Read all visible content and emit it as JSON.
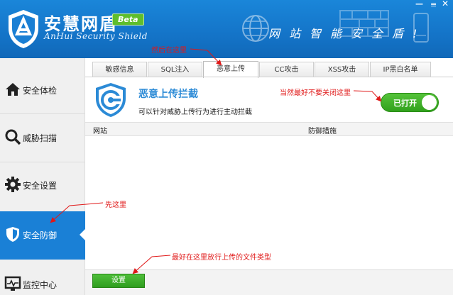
{
  "header": {
    "title": "安慧网盾",
    "badge": "Beta",
    "subtitle": "AnHui Security Shield",
    "slogan": "网站智能安全盾!"
  },
  "sidebar": {
    "items": [
      {
        "label": "安全体检",
        "icon": "home-icon"
      },
      {
        "label": "威胁扫描",
        "icon": "magnifier-icon"
      },
      {
        "label": "安全设置",
        "icon": "gear-icon"
      },
      {
        "label": "安全防御",
        "icon": "shield-icon",
        "active": true
      },
      {
        "label": "监控中心",
        "icon": "monitor-icon"
      }
    ]
  },
  "tabs": [
    {
      "label": "敏感信息"
    },
    {
      "label": "SQL注入"
    },
    {
      "label": "恶意上传",
      "active": true
    },
    {
      "label": "CC攻击"
    },
    {
      "label": "XSS攻击"
    },
    {
      "label": "IP黑白名单"
    }
  ],
  "feature": {
    "title": "恶意上传拦截",
    "description": "可以针对威胁上传行为进行主动拦截",
    "toggle_label": "已打开",
    "toggle_on": true
  },
  "table": {
    "columns": [
      "网站",
      "防御措施"
    ],
    "rows": []
  },
  "footer": {
    "settings_label": "设置"
  },
  "annotations": {
    "tab_note": "然后在这里",
    "toggle_note": "当然最好不要关闭这里",
    "sidebar_note": "先这里",
    "settings_note": "最好在这里放行上传的文件类型"
  },
  "colors": {
    "header_blue": "#1474c8",
    "accent_blue": "#1a80d6",
    "toggle_green": "#31a11d",
    "annotation_red": "#e01818"
  }
}
